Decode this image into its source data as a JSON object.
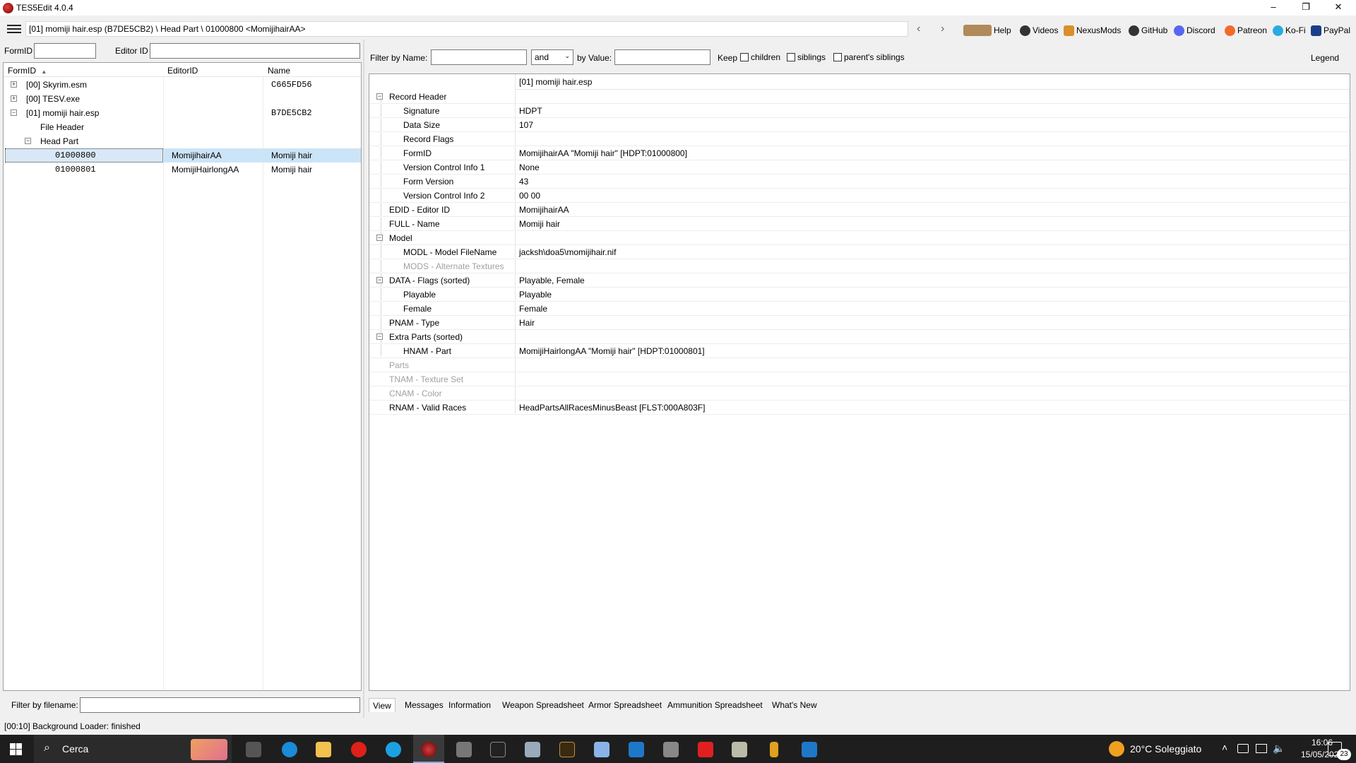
{
  "window": {
    "title": "TES5Edit 4.0.4",
    "minimize": "–",
    "maximize": "❐",
    "close": "✕"
  },
  "pathbar": {
    "path": "[01] momiji hair.esp (B7DE5CB2) \\ Head Part \\ 01000800 <MomijihairAA>",
    "back": "‹",
    "forward": "›",
    "links": [
      {
        "label": "Help",
        "icon": "book-icon",
        "color": "#8a5a2a"
      },
      {
        "label": "Videos",
        "icon": "videos-icon",
        "color": "#333333"
      },
      {
        "label": "NexusMods",
        "icon": "nexusmods-icon",
        "color": "#d98f2a"
      },
      {
        "label": "GitHub",
        "icon": "github-icon",
        "color": "#333333"
      },
      {
        "label": "Discord",
        "icon": "discord-icon",
        "color": "#5865f2"
      },
      {
        "label": "Patreon",
        "icon": "patreon-icon",
        "color": "#f26a2a"
      },
      {
        "label": "Ko-Fi",
        "icon": "kofi-icon",
        "color": "#29abe0"
      },
      {
        "label": "PayPal",
        "icon": "paypal-icon",
        "color": "#1a3e8a"
      }
    ]
  },
  "left": {
    "formid_label": "FormID",
    "editorid_label": "Editor ID",
    "columns": {
      "formid": "FormID",
      "editorid": "EditorID",
      "name": "Name"
    },
    "sort_indicator": "▲",
    "rows": [
      {
        "formid": "[00] Skyrim.esm",
        "editorid": "",
        "name": "C665FD56"
      },
      {
        "formid": "[00] TESV.exe",
        "editorid": "",
        "name": ""
      },
      {
        "formid": "[01] momiji hair.esp",
        "editorid": "",
        "name": "B7DE5CB2"
      },
      {
        "formid": "File Header",
        "editorid": "",
        "name": ""
      },
      {
        "formid": "Head Part",
        "editorid": "",
        "name": ""
      },
      {
        "formid": "01000800",
        "editorid": "MomijihairAA",
        "name": "Momiji hair"
      },
      {
        "formid": "01000801",
        "editorid": "MomijiHairlongAA",
        "name": "Momiji hair"
      }
    ],
    "filter_filename_label": "Filter by filename:"
  },
  "right": {
    "filter_name_label": "Filter by Name:",
    "filter_op": "and",
    "by_value_label": "by Value:",
    "keep_label": "Keep",
    "children_label": "children",
    "siblings_label": "siblings",
    "parents_siblings_label": "parent's siblings",
    "legend_label": "Legend",
    "file_header": "[01] momiji hair.esp",
    "rows": [
      {
        "key": "Record Header",
        "value": ""
      },
      {
        "key": "Signature",
        "value": "HDPT"
      },
      {
        "key": "Data Size",
        "value": "107"
      },
      {
        "key": "Record Flags",
        "value": ""
      },
      {
        "key": "FormID",
        "value": "MomijihairAA \"Momiji hair\" [HDPT:01000800]"
      },
      {
        "key": "Version Control Info 1",
        "value": "None"
      },
      {
        "key": "Form Version",
        "value": "43"
      },
      {
        "key": "Version Control Info 2",
        "value": "00 00"
      },
      {
        "key": "EDID - Editor ID",
        "value": "MomijihairAA"
      },
      {
        "key": "FULL - Name",
        "value": "Momiji hair"
      },
      {
        "key": "Model",
        "value": ""
      },
      {
        "key": "MODL - Model FileName",
        "value": "jacksh\\doa5\\momijihair.nif"
      },
      {
        "key": "MODS - Alternate Textures",
        "value": ""
      },
      {
        "key": "DATA - Flags (sorted)",
        "value": "Playable, Female"
      },
      {
        "key": "Playable",
        "value": "Playable"
      },
      {
        "key": "Female",
        "value": "Female"
      },
      {
        "key": "PNAM - Type",
        "value": "Hair"
      },
      {
        "key": "Extra Parts (sorted)",
        "value": ""
      },
      {
        "key": "HNAM - Part",
        "value": "MomijiHairlongAA \"Momiji hair\" [HDPT:01000801]"
      },
      {
        "key": "Parts",
        "value": ""
      },
      {
        "key": "TNAM - Texture Set",
        "value": ""
      },
      {
        "key": "CNAM - Color",
        "value": ""
      },
      {
        "key": "RNAM - Valid Races",
        "value": "HeadPartsAllRacesMinusBeast [FLST:000A803F]"
      }
    ],
    "tabs": [
      "View",
      "Messages",
      "Information",
      "Weapon Spreadsheet",
      "Armor Spreadsheet",
      "Ammunition Spreadsheet",
      "What's New"
    ]
  },
  "status": {
    "text": "[00:10] Background Loader: finished"
  },
  "taskbar": {
    "search": "Cerca",
    "weather": "20°C Soleggiato",
    "time": "16:06",
    "date": "15/05/2023",
    "notifications": "23"
  }
}
